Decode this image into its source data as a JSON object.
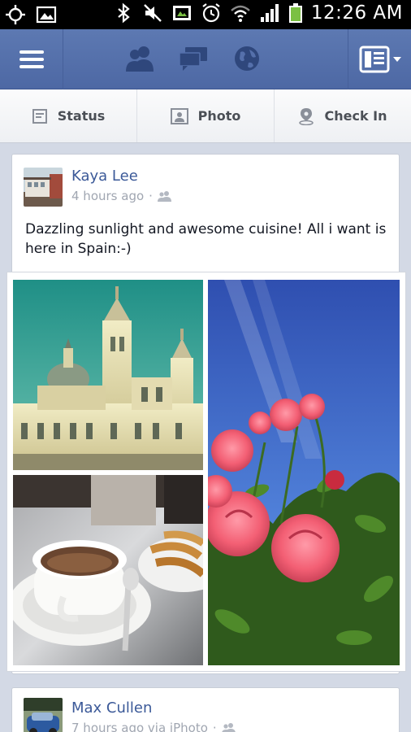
{
  "status_bar": {
    "time": "12:26 AM",
    "icons": [
      "gps-icon",
      "gallery-icon",
      "bluetooth-icon",
      "mute-icon",
      "screenshot-icon",
      "alarm-icon",
      "wifi-icon",
      "signal-icon",
      "battery-icon"
    ]
  },
  "top_bar": {
    "icons": [
      "menu-icon",
      "friend-requests-icon",
      "messages-icon",
      "notifications-globe-icon",
      "news-feed-icon"
    ]
  },
  "publisher": {
    "status_label": "Status",
    "photo_label": "Photo",
    "checkin_label": "Check In"
  },
  "stories": [
    {
      "author": "Kaya Lee",
      "time": "4 hours ago",
      "separator": "·",
      "message": "Dazzling sunlight and awesome cuisine! All i want is here in Spain:-)",
      "photos": [
        "cathedral-photo",
        "coffee-churros-photo",
        "roses-photo"
      ]
    },
    {
      "author": "Max Cullen",
      "time": "7 hours ago via iPhoto",
      "separator": "·"
    }
  ],
  "colors": {
    "brand_blue": "#4d68a4",
    "link_blue": "#3b5998",
    "feed_bg": "#d3d9e5"
  }
}
